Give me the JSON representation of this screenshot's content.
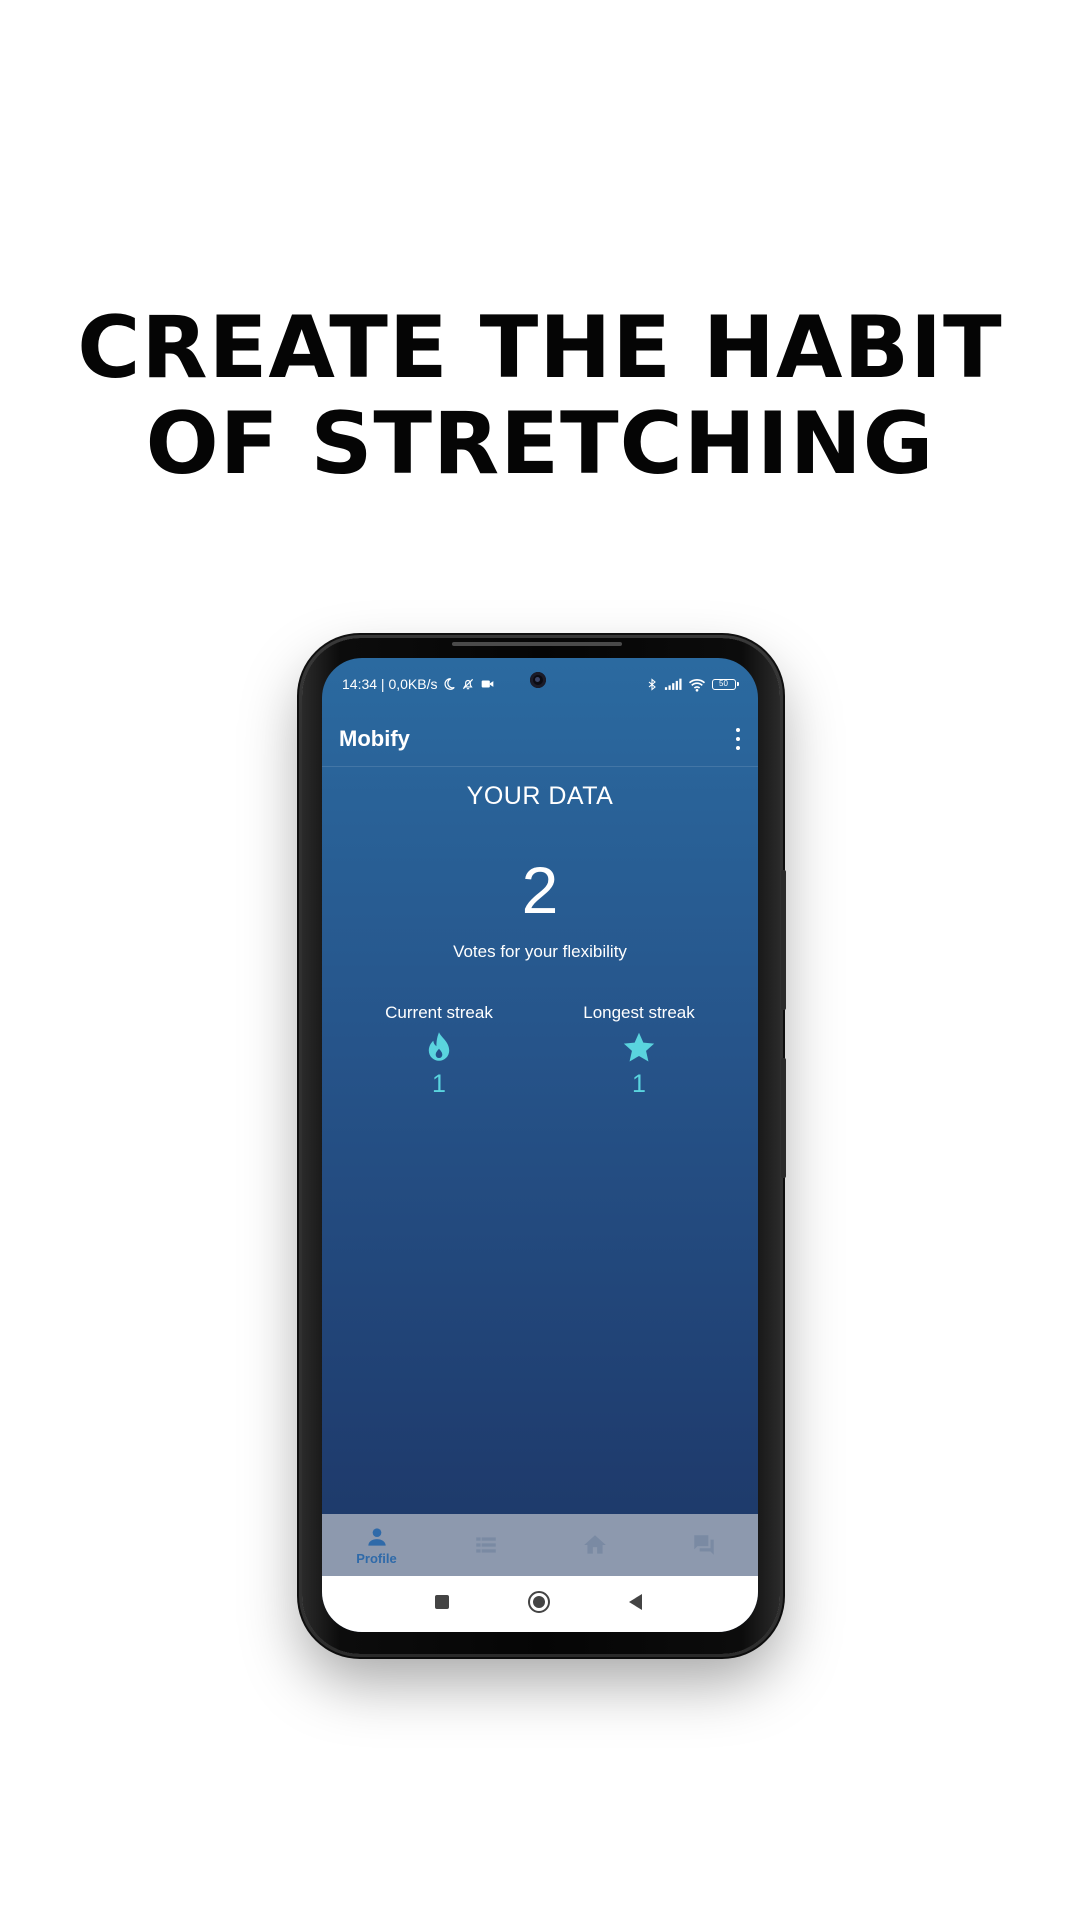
{
  "headline": {
    "line1": "CREATE THE HABIT",
    "line2": "OF STRETCHING"
  },
  "status_bar": {
    "time_and_speed": "14:34 | 0,0KB/s",
    "battery": "50",
    "icons": [
      "moon-icon",
      "bell-off-icon",
      "video-icon",
      "bluetooth-icon",
      "signal-icon",
      "wifi-icon",
      "battery-icon"
    ]
  },
  "app_bar": {
    "title": "Mobify",
    "menu_icon": "more-vert-icon"
  },
  "profile": {
    "section_title": "YOUR DATA",
    "votes_count": "2",
    "votes_label": "Votes for your flexibility",
    "current_streak": {
      "label": "Current streak",
      "value": "1",
      "icon": "flame-icon"
    },
    "longest_streak": {
      "label": "Longest streak",
      "value": "1",
      "icon": "star-icon"
    }
  },
  "bottom_nav": {
    "items": [
      {
        "label": "Profile",
        "icon": "person-icon",
        "active": true
      },
      {
        "label": "",
        "icon": "list-icon",
        "active": false
      },
      {
        "label": "",
        "icon": "home-icon",
        "active": false
      },
      {
        "label": "",
        "icon": "forum-icon",
        "active": false
      }
    ]
  },
  "system_nav": {
    "buttons": [
      "recents-button",
      "home-button",
      "back-button"
    ]
  },
  "colors": {
    "screen_gradient_top": "#2b6aa0",
    "screen_gradient_bottom": "#1d3663",
    "accent_teal": "#5ad4de",
    "nav_background": "#8d99ae",
    "nav_active": "#2f6aa9",
    "nav_inactive": "#7a8aa3"
  }
}
